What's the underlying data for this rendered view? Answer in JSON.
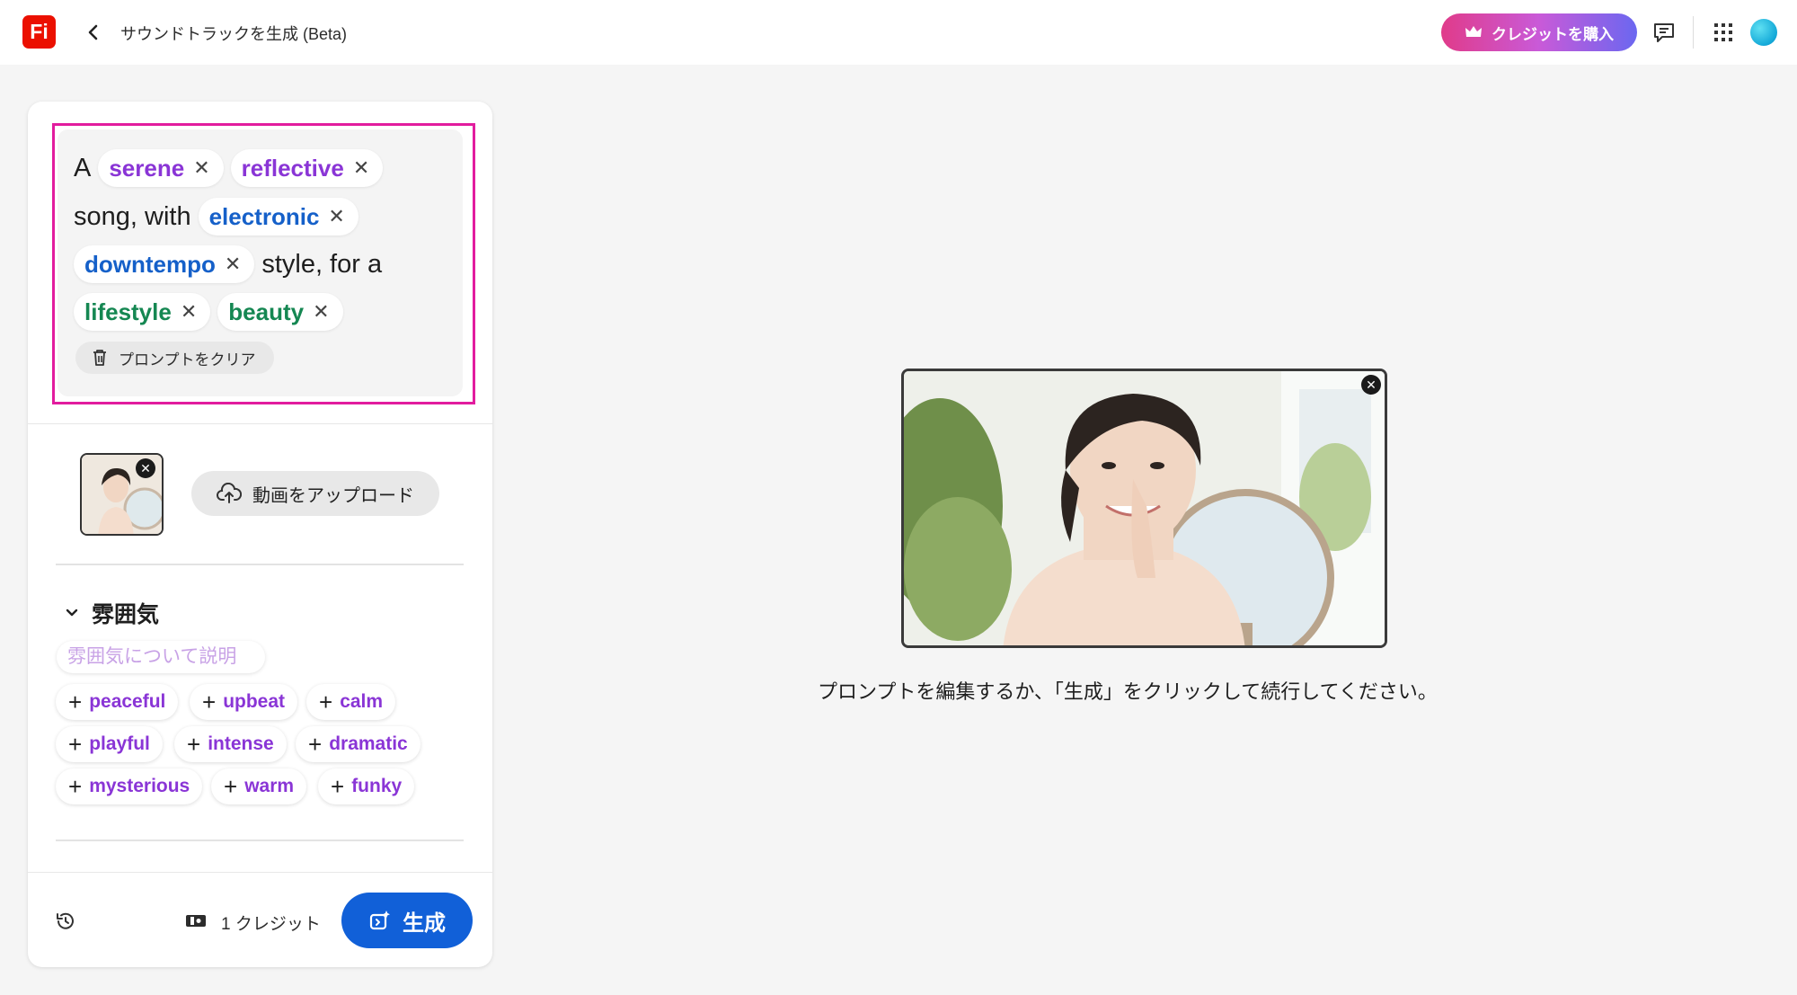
{
  "header": {
    "app_logo_text": "Fi",
    "title": "サウンドトラックを生成 (Beta)",
    "buy_credits_label": "クレジットを購入",
    "icons": [
      "chevron-left-icon",
      "crown-icon",
      "feedback-icon",
      "apps-grid-icon",
      "avatar"
    ]
  },
  "prompt": {
    "words": [
      "A",
      "song, with",
      "style, for a"
    ],
    "chips": [
      {
        "label": "serene",
        "color": "#8a35d6"
      },
      {
        "label": "reflective",
        "color": "#8a35d6"
      },
      {
        "label": "electronic",
        "color": "#1560c9"
      },
      {
        "label": "downtempo",
        "color": "#1560c9"
      },
      {
        "label": "lifestyle",
        "color": "#158752"
      },
      {
        "label": "beauty",
        "color": "#158752"
      }
    ],
    "clear_label": "プロンプトをクリア",
    "highlight_color": "#e21c9e"
  },
  "upload": {
    "button_label": "動画をアップロード"
  },
  "mood": {
    "title": "雰囲気",
    "placeholder": "雰囲気について説明",
    "tags": [
      "peaceful",
      "upbeat",
      "calm",
      "playful",
      "intense",
      "dramatic",
      "mysterious",
      "warm",
      "funky"
    ]
  },
  "footer": {
    "credit_label": "1 クレジット",
    "generate_label": "生成",
    "accent_color": "#1160d8"
  },
  "preview": {
    "instruction": "プロンプトを編集するか、「生成」をクリックして続行してください。"
  }
}
